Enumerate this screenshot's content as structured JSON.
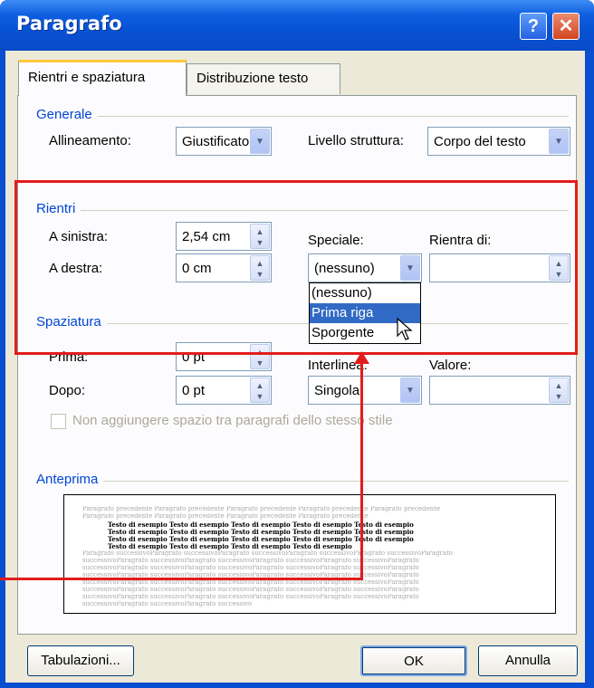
{
  "window": {
    "title": "Paragrafo"
  },
  "titlebar": {
    "help": "?",
    "close": "✕"
  },
  "tabs": [
    {
      "label": "Rientri e spaziatura"
    },
    {
      "label": "Distribuzione testo"
    }
  ],
  "generale": {
    "heading": "Generale",
    "alignment_label": "Allineamento:",
    "alignment_value": "Giustificato",
    "outline_label": "Livello struttura:",
    "outline_value": "Corpo del testo"
  },
  "rientri": {
    "heading": "Rientri",
    "left_label": "A sinistra:",
    "left_value": "2,54 cm",
    "right_label": "A destra:",
    "right_value": "0 cm",
    "special_label": "Speciale:",
    "special_value": "(nessuno)",
    "by_label": "Rientra di:",
    "by_value": "",
    "special_options": [
      "(nessuno)",
      "Prima riga",
      "Sporgente"
    ],
    "special_selected_option": "Prima riga"
  },
  "spaziatura": {
    "heading": "Spaziatura",
    "before_label": "Prima:",
    "before_value": "0 pt",
    "after_label": "Dopo:",
    "after_value": "0 pt",
    "line_label": "Interlinea:",
    "line_value": "Singola",
    "value_label": "Valore:",
    "value_value": "",
    "no_space_checkbox": "Non aggiungere spazio tra paragrafi dello stesso stile"
  },
  "anteprima": {
    "heading": "Anteprima",
    "prev_lines": [
      "Paragrafo precedente Paragrafo precedente Paragrafo precedente Paragrafo precedente Paragrafo precedente",
      "Paragrafo precedente Paragrafo precedente Paragrafo precedente Paragrafo precedente"
    ],
    "sample_lines": [
      "Testo di esempio Testo di esempio Testo di esempio Testo di esempio Testo di esempio",
      "Testo di esempio Testo di esempio Testo di esempio Testo di esempio Testo di esempio",
      "Testo di esempio Testo di esempio Testo di esempio Testo di esempio Testo di esempio",
      "Testo di esempio Testo di esempio Testo di esempio Testo di esempio"
    ],
    "next_lines": [
      "Paragrafo successivoParagrafo successivoParagrafo successivoParagrafo successivoParagrafo successivoParagrafo",
      "successivoParagrafo successivoParagrafo successivoParagrafo successivoParagrafo successivoParagrafo",
      "successivoParagrafo successivoParagrafo successivoParagrafo successivoParagrafo successivoParagrafo",
      "successivoParagrafo successivoParagrafo successivoParagrafo successivoParagrafo successivoParagrafo",
      "successivoParagrafo successivoParagrafo successivoParagrafo successivoParagrafo successivoParagrafo",
      "successivoParagrafo successivoParagrafo successivoParagrafo successivoParagrafo successivoParagrafo",
      "successivoParagrafo successivoParagrafo successivoParagrafo successivoParagrafo successivoParagrafo",
      "successivoParagrafo successivoParagrafo successivo"
    ]
  },
  "buttons": {
    "tabs": "Tabulazioni...",
    "ok": "OK",
    "cancel": "Annulla"
  },
  "colors": {
    "annotation": "#e21c1c",
    "section_heading": "#0046d5",
    "selection": "#316ac5"
  }
}
